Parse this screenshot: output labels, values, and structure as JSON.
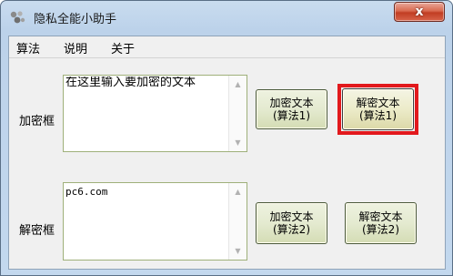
{
  "window": {
    "title": "隐私全能小助手",
    "close_glyph": "x"
  },
  "menu": {
    "items": [
      "算法",
      "说明",
      "关于"
    ]
  },
  "encrypt_row": {
    "label": "加密框",
    "text": "在这里输入要加密的文本",
    "button1": {
      "line1": "加密文本",
      "line2": "(算法1)"
    },
    "button2": {
      "line1": "解密文本",
      "line2": "(算法1)"
    }
  },
  "decrypt_row": {
    "label": "解密框",
    "text": "pc6.com",
    "button1": {
      "line1": "加密文本",
      "line2": "(算法2)"
    },
    "button2": {
      "line1": "解密文本",
      "line2": "(算法2)"
    }
  },
  "colors": {
    "highlight": "#e2191d",
    "textbox_border": "#9fb07a",
    "button_face": "#ecebc9"
  },
  "icons": {
    "app": "puzzle-sprites-icon",
    "scroll_up": "triangle-up",
    "scroll_down": "triangle-down"
  }
}
